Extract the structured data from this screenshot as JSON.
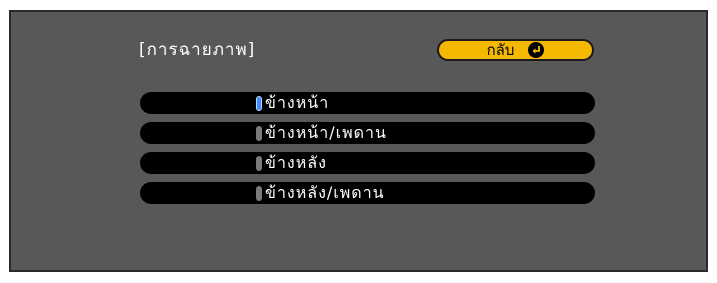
{
  "menu": {
    "title": "[การฉายภาพ]",
    "back_label": "กลับ",
    "back_icon": "enter-return-icon",
    "accent_color": "#f5b800",
    "selected_color": "#3a8cff",
    "options": [
      {
        "label": "ข้างหน้า",
        "selected": true
      },
      {
        "label": "ข้างหน้า/เพดาน",
        "selected": false
      },
      {
        "label": "ข้างหลัง",
        "selected": false
      },
      {
        "label": "ข้างหลัง/เพดาน",
        "selected": false
      }
    ]
  }
}
